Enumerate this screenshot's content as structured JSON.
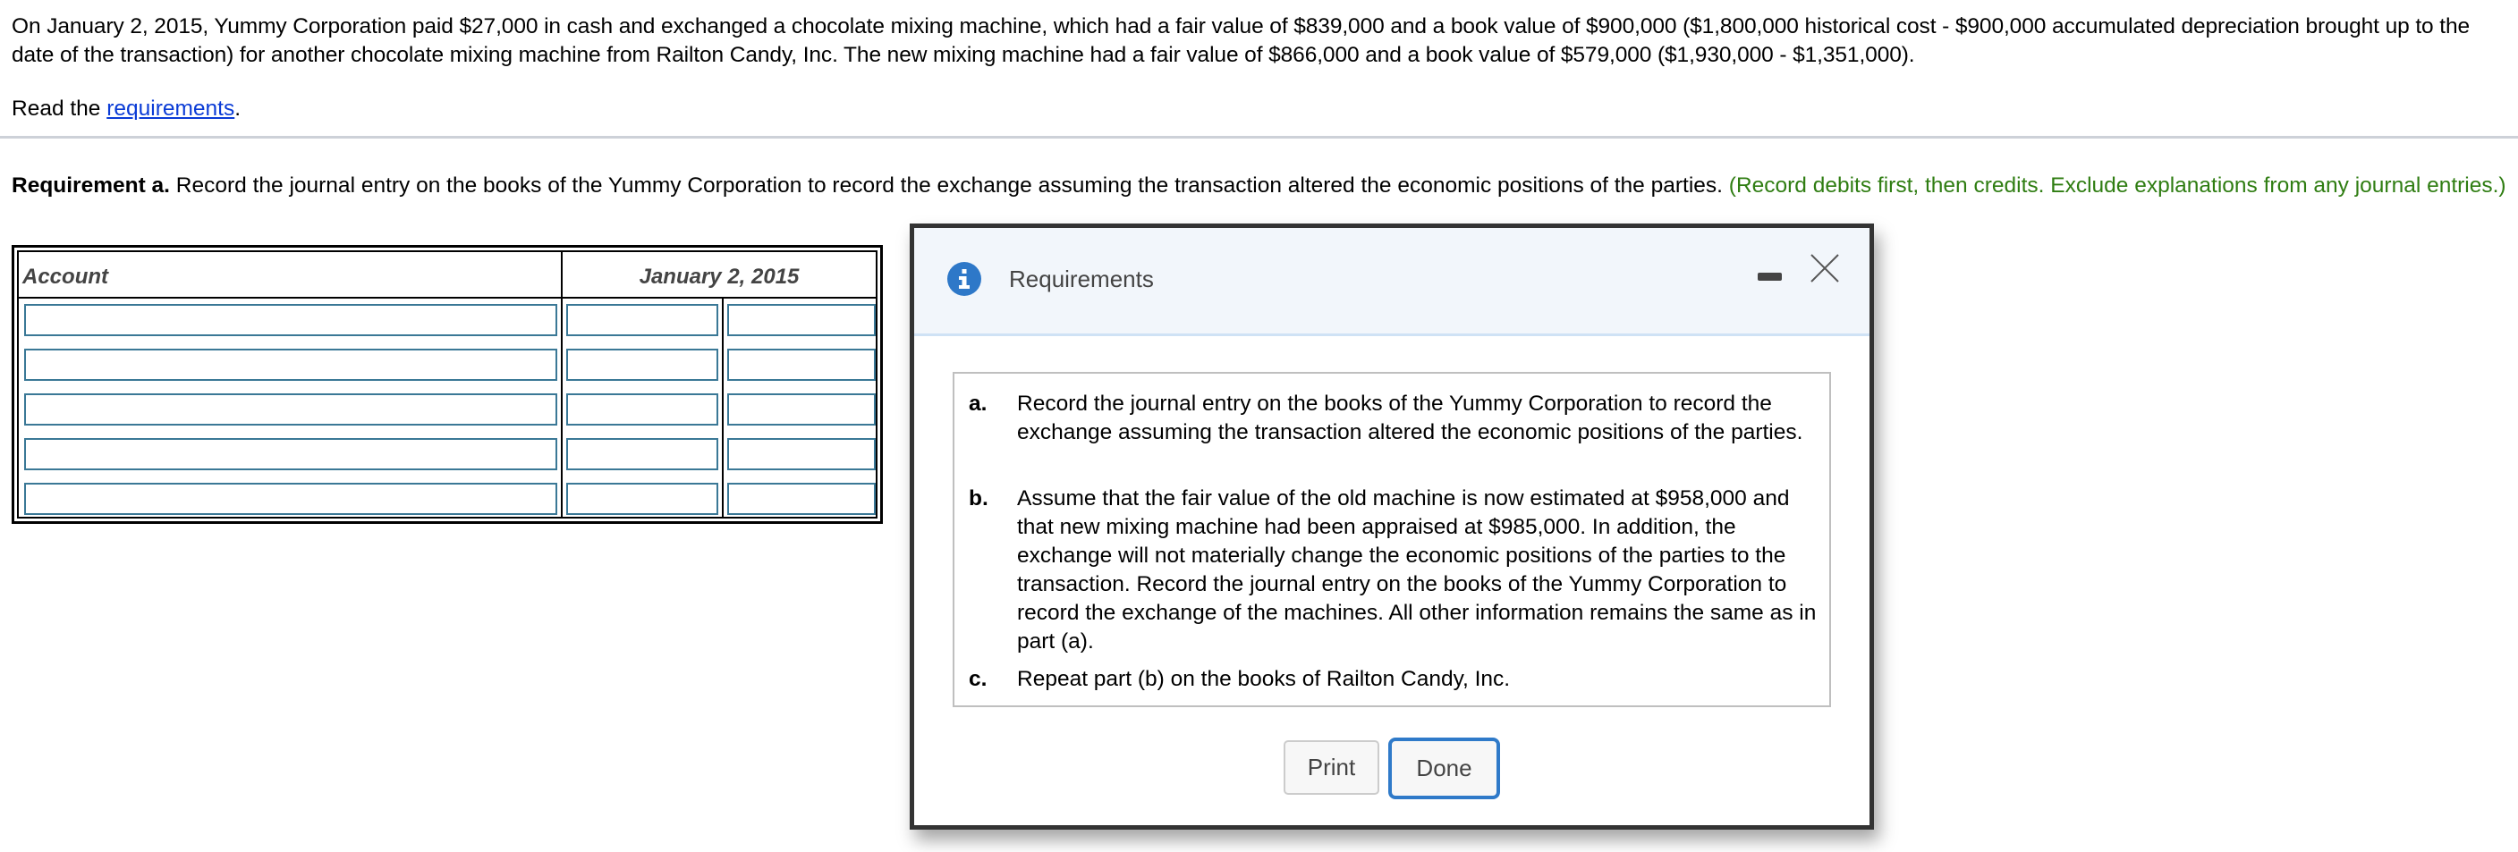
{
  "problem": {
    "text": "On January 2, 2015, Yummy Corporation paid $27,000 in cash and exchanged a chocolate mixing machine, which had a fair value of $839,000 and a book value of $900,000 ($1,800,000 historical cost - $900,000 accumulated depreciation brought up to the date of the transaction) for another chocolate mixing machine from Railton Candy, Inc. The new mixing machine had a fair value of $866,000 and a book value of $579,000 ($1,930,000 - $1,351,000).",
    "read_prefix": "Read the ",
    "read_link": "requirements",
    "read_suffix": "."
  },
  "requirement_a": {
    "label": "Requirement a.",
    "text": " Record the journal entry on the books of the Yummy Corporation to record the exchange assuming the transaction altered the economic positions of the parties. ",
    "instruction": "(Record debits first, then credits. Exclude explanations from any journal entries.)"
  },
  "journal": {
    "headers": {
      "account": "Account",
      "date": "January 2, 2015"
    },
    "rows": [
      {
        "account": "",
        "debit": "",
        "credit": ""
      },
      {
        "account": "",
        "debit": "",
        "credit": ""
      },
      {
        "account": "",
        "debit": "",
        "credit": ""
      },
      {
        "account": "",
        "debit": "",
        "credit": ""
      },
      {
        "account": "",
        "debit": "",
        "credit": ""
      }
    ]
  },
  "modal": {
    "title": "Requirements",
    "icon": "info-icon",
    "minimize_icon": "minimize-icon",
    "close_icon": "close-icon",
    "items": [
      {
        "letter": "a.",
        "text": "Record the journal entry on the books of the Yummy Corporation to record the exchange assuming the transaction altered the economic positions of the parties."
      },
      {
        "letter": "b.",
        "text": "Assume that the fair value of the old machine is now estimated at $958,000 and that new mixing machine had been appraised at $985,000. In addition, the exchange will not materially change the economic positions of the parties to the transaction. Record the journal entry on the books of the Yummy Corporation to record the exchange of the machines. All other information remains the same as in part (a)."
      },
      {
        "letter": "c.",
        "text": "Repeat part (b) on the books of Railton Candy, Inc."
      }
    ],
    "buttons": {
      "print": "Print",
      "done": "Done"
    }
  },
  "colors": {
    "link": "#0a3bd6",
    "instruction_green": "#2f7d12",
    "input_border": "#3a7896",
    "accent_blue": "#2f7ac9",
    "modal_header_bg": "#f2f6fb"
  }
}
